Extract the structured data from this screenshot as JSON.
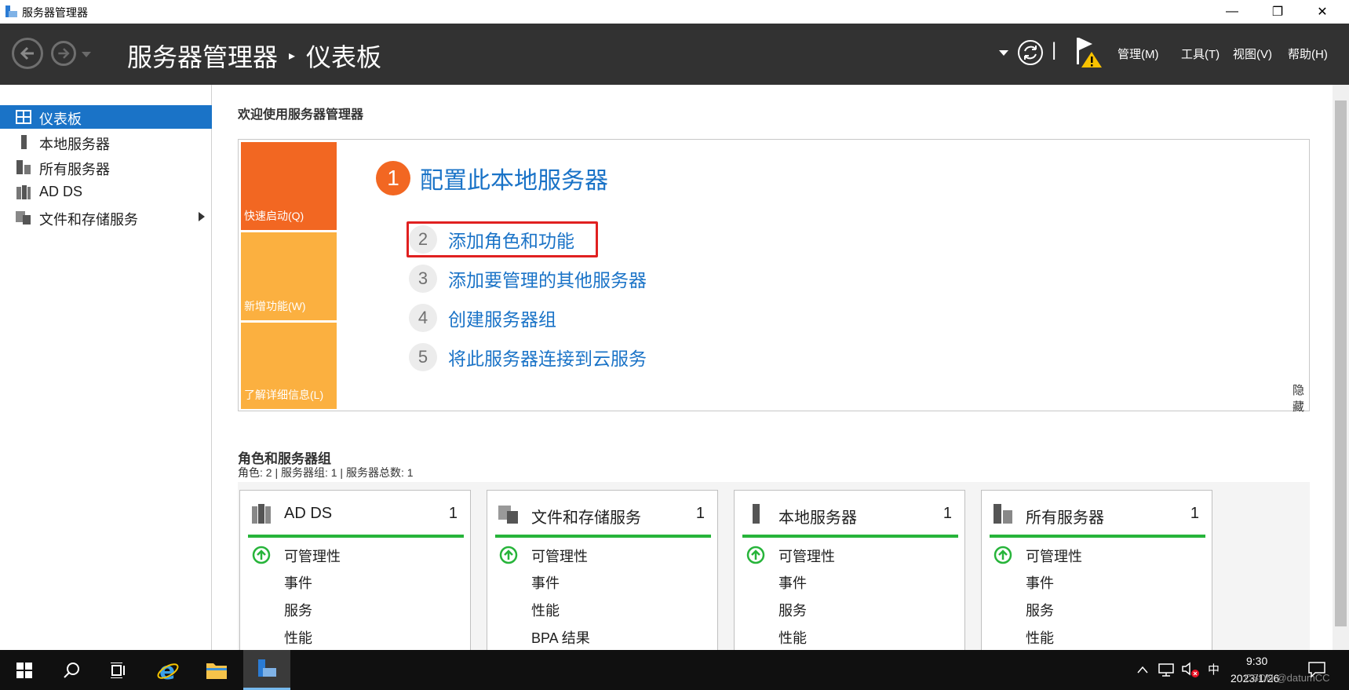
{
  "window": {
    "title": "服务器管理器",
    "minimize": "—",
    "restore": "❐",
    "close": "✕"
  },
  "header": {
    "breadcrumb_root": "服务器管理器",
    "breadcrumb_separator": "▸",
    "breadcrumb_current": "仪表板",
    "menus": [
      "管理(M)",
      "工具(T)",
      "视图(V)",
      "帮助(H)"
    ],
    "divider": "|"
  },
  "sidebar": {
    "items": [
      {
        "label": "仪表板",
        "icon": "dashboard-icon",
        "active": true
      },
      {
        "label": "本地服务器",
        "icon": "server-icon"
      },
      {
        "label": "所有服务器",
        "icon": "servers-icon"
      },
      {
        "label": "AD DS",
        "icon": "ad-ds-icon"
      },
      {
        "label": "文件和存储服务",
        "icon": "file-storage-icon",
        "has_submenu": true
      }
    ]
  },
  "welcome": {
    "title": "欢迎使用服务器管理器",
    "tiles": [
      "快速启动(Q)",
      "新增功能(W)",
      "了解详细信息(L)"
    ],
    "steps": [
      {
        "num": "1",
        "label": "配置此本地服务器"
      },
      {
        "num": "2",
        "label": "添加角色和功能"
      },
      {
        "num": "3",
        "label": "添加要管理的其他服务器"
      },
      {
        "num": "4",
        "label": "创建服务器组"
      },
      {
        "num": "5",
        "label": "将此服务器连接到云服务"
      }
    ],
    "hide": "隐藏"
  },
  "roles": {
    "title": "角色和服务器组",
    "summary": "角色: 2 | 服务器组: 1 | 服务器总数: 1",
    "cards": [
      {
        "title": "AD DS",
        "count": "1",
        "rows": [
          "可管理性",
          "事件",
          "服务",
          "性能"
        ]
      },
      {
        "title": "文件和存储服务",
        "count": "1",
        "rows": [
          "可管理性",
          "事件",
          "性能",
          "BPA 结果"
        ]
      },
      {
        "title": "本地服务器",
        "count": "1",
        "rows": [
          "可管理性",
          "事件",
          "服务",
          "性能"
        ]
      },
      {
        "title": "所有服务器",
        "count": "1",
        "rows": [
          "可管理性",
          "事件",
          "服务",
          "性能"
        ]
      }
    ]
  },
  "taskbar": {
    "ime": "中",
    "time": "9:30",
    "date": "2023/1/26",
    "watermark": "CSDN @datumCC"
  },
  "colors": {
    "accent": "#1a73c7",
    "orange": "#f26722",
    "amber": "#fbb040",
    "green": "#27b43a",
    "header_bg": "#323232",
    "highlight": "#e02020"
  }
}
